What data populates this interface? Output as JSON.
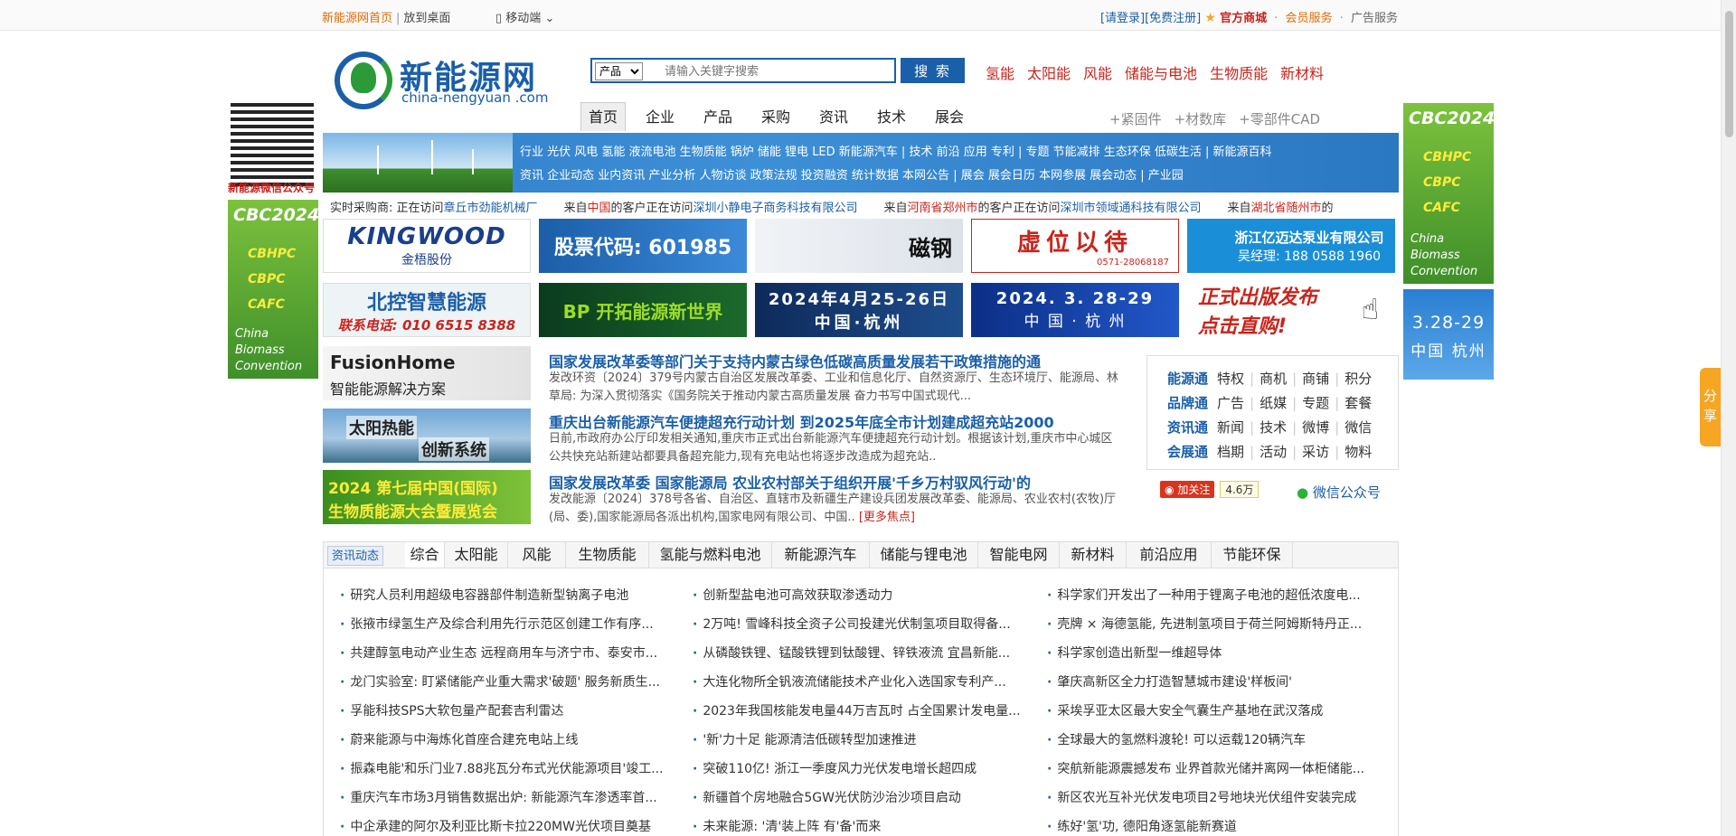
{
  "topbar": {
    "home": "新能源网首页",
    "desktop": "放到桌面",
    "mobile": "移动端",
    "login": "[请登录]",
    "register": "[免费注册]",
    "shop": "官方商城",
    "member": "会员服务",
    "ads": "广告服务"
  },
  "logo": {
    "cn": "新能源网",
    "en": "china-nengyuan .com"
  },
  "search": {
    "category": "产品",
    "placeholder": "请输入关键字搜索",
    "button": "搜 索"
  },
  "hotwords": [
    "氢能",
    "太阳能",
    "风能",
    "储能与电池",
    "生物质能",
    "新材料"
  ],
  "mainnav": [
    "首页",
    "企业",
    "产品",
    "采购",
    "资讯",
    "技术",
    "展会"
  ],
  "subnav2": [
    "+紧固件",
    "+材数库",
    "+零部件CAD"
  ],
  "banner": {
    "row1": "行业 光伏 风电 氢能 液流电池 生物质能 锅炉 储能 锂电 LED 新能源汽车 | 技术 前沿 应用 专利 | 专题 节能减排 生态环保 低碳生活 | 新能源百科",
    "row2": "资讯 企业动态 业内资讯 产业分析 人物访谈 政策法规 投资融资 统计数据 本网公告 | 展会 展会日历 本网参展 展会动态 | 产业园"
  },
  "qr_caption": "新能源微信公众号",
  "cbc": {
    "title": "CBC2024",
    "items": [
      "CBHPC",
      "CBPC",
      "CAFC"
    ],
    "sub": [
      "China",
      "Biomass",
      "Convention"
    ]
  },
  "right_date": {
    "line1": "3.28-29",
    "line2": "中国 杭州"
  },
  "marquee": {
    "label": "实时采购商:",
    "text1": "正在访问",
    "loc1": "章丘市劲能机械厂",
    "p2a": "来自",
    "loc2": "中国",
    "p2b": "的客户正在访问",
    "comp2": "深圳小静电子商务科技有限公司",
    "p3a": "来自",
    "loc3": "河南省郑州市",
    "p3b": "的客户正在访问",
    "comp3": "深圳市领域通科技有限公司",
    "p4a": "来自",
    "loc4": "湖北省随州市",
    "p4b": "的"
  },
  "ads": [
    {
      "text": "KINGWOOD",
      "sub": "金梧股份"
    },
    {
      "text": "股票代码: 601985"
    },
    {
      "text": "磁钢"
    },
    {
      "text": "虚位以待",
      "sub": "0571-28068187"
    },
    {
      "text": "浙江亿迈达泵业有限公司",
      "sub": "吴经理: 188 0588 1960"
    },
    {
      "text": "北控智慧能源",
      "sub": "联系电话: 010 6515 8388"
    },
    {
      "text": "BP 开拓能源新世界"
    },
    {
      "text": "2024年4月25-26日",
      "sub": "中国·杭州"
    },
    {
      "text": "2024. 3. 28-29",
      "sub": "中 国 · 杭 州"
    },
    {
      "text": "正式出版发布",
      "sub": "点击直购!"
    }
  ],
  "featured_imgs": [
    {
      "t1": "FusionHome",
      "t2": "智能能源解决方案"
    },
    {
      "t1": "太阳热能",
      "t2": "创新系统"
    },
    {
      "t1": "2024 第七届中国(国际)",
      "t2": "生物质能源大会暨展览会"
    }
  ],
  "featured_news": [
    {
      "title": "国家发展改革委等部门关于支持内蒙古绿色低碳高质量发展若干政策措施的通",
      "summary": "发改环资〔2024〕379号内蒙古自治区发展改革委、工业和信息化厅、自然资源厅、生态环境厅、能源局、林草局: 为深入贯彻落实《国务院关于推动内蒙古高质量发展 奋力书写中国式现代..."
    },
    {
      "title": "重庆出台新能源汽车便捷超充行动计划 到2025年底全市计划建成超充站2000",
      "summary": "日前,市政府办公厅印发相关通知,重庆市正式出台新能源汽车便捷超充行动计划。根据该计划,重庆市中心城区公共快充站新建站都要具备超充能力,现有充电站也将逐步改造成为超充站.."
    },
    {
      "title": "国家发展改革委 国家能源局 农业农村部关于组织开展'千乡万村驭风行动'的",
      "summary": "发改能源〔2024〕378号各省、自治区、直辖市及新疆生产建设兵团发展改革委、能源局、农业农村(农牧)厅(局、委),国家能源局各派出机构,国家电网有限公司、中国..",
      "more": "[更多焦点]"
    }
  ],
  "services": [
    {
      "head": "能源通",
      "items": [
        "特权",
        "商机",
        "商铺",
        "积分"
      ]
    },
    {
      "head": "品牌通",
      "items": [
        "广告",
        "纸媒",
        "专题",
        "套餐"
      ]
    },
    {
      "head": "资讯通",
      "items": [
        "新闻",
        "技术",
        "微博",
        "微信"
      ]
    },
    {
      "head": "会展通",
      "items": [
        "档期",
        "活动",
        "采访",
        "物料"
      ]
    }
  ],
  "social": {
    "weibo": "加关注",
    "weibo_count": "4.6万",
    "wechat": "微信公众号"
  },
  "share": "分享",
  "tabs": {
    "label": "资讯动态",
    "items": [
      "综合",
      "太阳能",
      "风能",
      "生物质能",
      "氢能与燃料电池",
      "新能源汽车",
      "储能与锂电池",
      "智能电网",
      "新材料",
      "前沿应用",
      "节能环保"
    ]
  },
  "news": {
    "col1": [
      "研究人员利用超级电容器部件制造新型钠离子电池",
      "张掖市绿氢生产及综合利用先行示范区创建工作有序...",
      "共建醇氢电动产业生态 远程商用车与济宁市、泰安市...",
      "龙门实验室: 盯紧储能产业重大需求'破题' 服务新质生...",
      "孚能科技SPS大软包量产配套吉利雷达",
      "蔚来能源与中海炼化首座合建充电站上线",
      "振森电能'和乐门业7.88兆瓦分布式光伏能源项目'竣工...",
      "重庆汽车市场3月销售数据出炉: 新能源汽车渗透率首...",
      "中企承建的阿尔及利亚比斯卡拉220MW光伏项目奠基"
    ],
    "col2": [
      "创新型盐电池可高效获取渗透动力",
      "2万吨! 雪峰科技全资子公司投建光伏制氢项目取得备...",
      "从磷酸铁锂、锰酸铁锂到钛酸锂、锌铁液流 宜昌新能...",
      "大连化物所全钒液流储能技术产业化入选国家专利产...",
      "2023年我国核能发电量44万吉瓦时 占全国累计发电量...",
      "'新'力十足 能源清洁低碳转型加速推进",
      "突破110亿! 浙江一季度风力光伏发电增长超四成",
      "新疆首个房地融合5GW光伏防沙治沙项目启动",
      "未来能源: '清'装上阵 有'备'而来"
    ],
    "col3": [
      "科学家们开发出了一种用于锂离子电池的超低浓度电...",
      "壳牌 × 海德氢能, 先进制氢项目于荷兰阿姆斯特丹正...",
      "科学家创造出新型一维超导体",
      "肇庆高新区全力打造智慧城市建设'样板间'",
      "采埃孚亚太区最大安全气囊生产基地在武汉落成",
      "全球最大的氢燃料渡轮! 可以运载120辆汽车",
      "突航新能源震撼发布 业界首款光储并离网一体柜储能...",
      "新区农光互补光伏发电项目2号地块光伏组件安装完成",
      "练好'氢'功, 德阳角逐氢能新赛道"
    ]
  }
}
